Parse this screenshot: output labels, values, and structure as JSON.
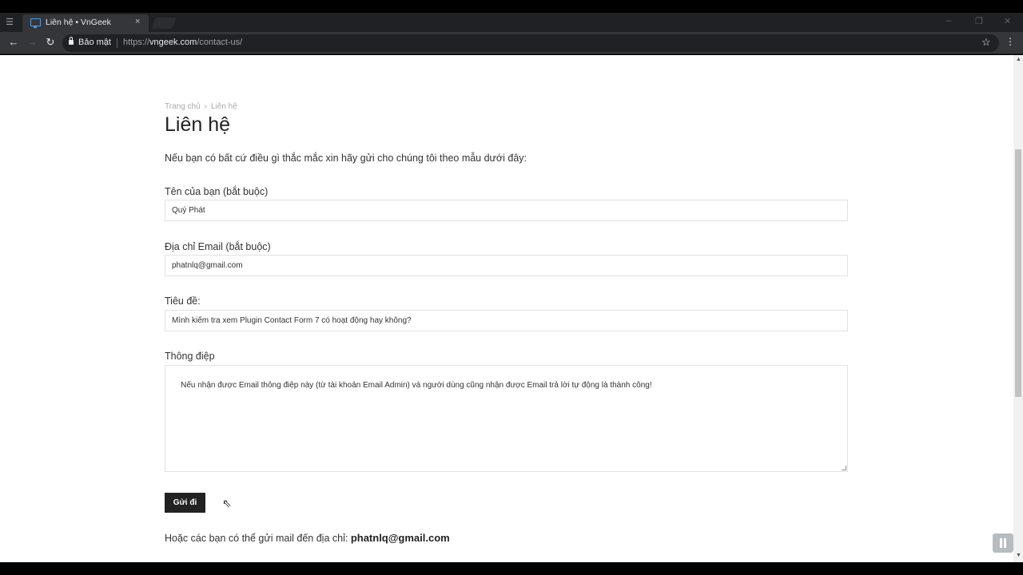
{
  "browser": {
    "tab_title": "Liên hệ • VnGeek",
    "tab_close": "×",
    "security_label": "Bảo mật",
    "url_scheme": "https://",
    "url_host": "vngeek.com",
    "url_path": "/contact-us/",
    "icons": [
      "menu-icon",
      "close-icon",
      "back-icon",
      "forward-icon",
      "reload-icon",
      "lock-icon",
      "star-icon",
      "kebab-menu-icon"
    ]
  },
  "breadcrumb": {
    "home": "Trang chủ",
    "separator": "›",
    "current": "Liên hệ"
  },
  "page": {
    "title": "Liên hệ",
    "intro": "Nếu bạn có bất cứ điều gì thắc mắc xin hãy gửi cho chúng tôi theo mẫu dưới đây:"
  },
  "form": {
    "name_label": "Tên của bạn (bắt buộc)",
    "name_value": "Quý Phát",
    "email_label": "Địa chỉ Email (bắt buộc)",
    "email_value": "phatnlq@gmail.com",
    "subject_label": "Tiêu đề:",
    "subject_value": "Mình kiểm tra xem Plugin Contact Form 7 có hoạt động hay không?",
    "message_label": "Thông điệp",
    "message_value": "Nếu nhận được Email thông điệp này (từ tài khoản Email Admin) và người dùng cũng nhận được Email trả lời tự động là thành công!",
    "submit_label": "Gửi đi"
  },
  "footer": {
    "text": "Hoặc các bạn có thể gửi mail đến địa chỉ: ",
    "email": "phatnlq@gmail.com"
  }
}
